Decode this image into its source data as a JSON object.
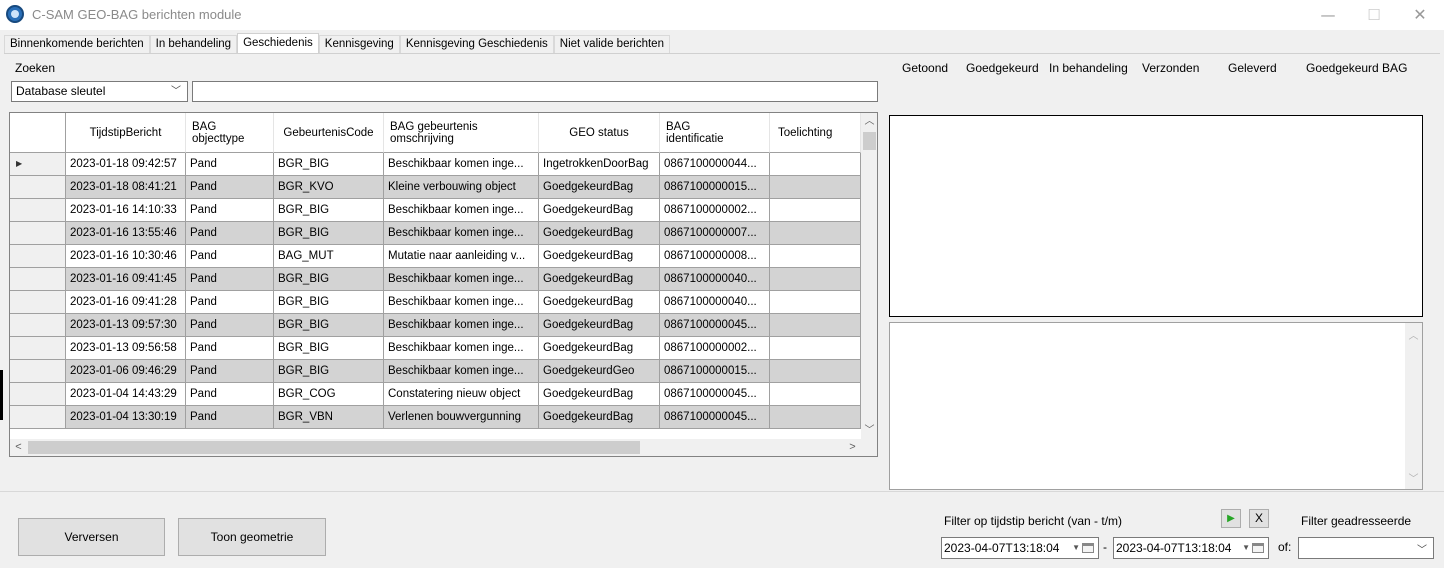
{
  "window": {
    "title": "C-SAM GEO-BAG berichten module",
    "minimize": "—",
    "maximize": "☐",
    "close": "✕"
  },
  "tabs": [
    {
      "label": "Binnenkomende berichten",
      "active": false
    },
    {
      "label": "In behandeling",
      "active": false
    },
    {
      "label": "Geschiedenis",
      "active": true
    },
    {
      "label": "Kennisgeving",
      "active": false
    },
    {
      "label": "Kennisgeving Geschiedenis",
      "active": false
    },
    {
      "label": "Niet valide berichten",
      "active": false
    }
  ],
  "search": {
    "label": "Zoeken",
    "field_selected": "Database sleutel",
    "query": ""
  },
  "status_columns": [
    "Getoond",
    "Goedgekeurd",
    "In behandeling",
    "Verzonden",
    "Geleverd",
    "Goedgekeurd BAG"
  ],
  "grid": {
    "columns": [
      "TijdstipBericht",
      "BAG\nobjecttype",
      "GebeurtenisCode",
      "BAG gebeurtenis\nomschrijving",
      "GEO status",
      "BAG\nidentificatie",
      "Toelichting"
    ],
    "current_row_indicator": "▶",
    "rows": [
      [
        "2023-01-18 09:42:57",
        "Pand",
        "BGR_BIG",
        "Beschikbaar komen inge...",
        "IngetrokkenDoorBag",
        "0867100000044...",
        ""
      ],
      [
        "2023-01-18 08:41:21",
        "Pand",
        "BGR_KVO",
        "Kleine verbouwing object",
        "GoedgekeurdBag",
        "0867100000015...",
        ""
      ],
      [
        "2023-01-16 14:10:33",
        "Pand",
        "BGR_BIG",
        "Beschikbaar komen inge...",
        "GoedgekeurdBag",
        "0867100000002...",
        ""
      ],
      [
        "2023-01-16 13:55:46",
        "Pand",
        "BGR_BIG",
        "Beschikbaar komen inge...",
        "GoedgekeurdBag",
        "0867100000007...",
        ""
      ],
      [
        "2023-01-16 10:30:46",
        "Pand",
        "BAG_MUT",
        "Mutatie naar aanleiding v...",
        "GoedgekeurdBag",
        "0867100000008...",
        ""
      ],
      [
        "2023-01-16 09:41:45",
        "Pand",
        "BGR_BIG",
        "Beschikbaar komen inge...",
        "GoedgekeurdBag",
        "0867100000040...",
        ""
      ],
      [
        "2023-01-16 09:41:28",
        "Pand",
        "BGR_BIG",
        "Beschikbaar komen inge...",
        "GoedgekeurdBag",
        "0867100000040...",
        ""
      ],
      [
        "2023-01-13 09:57:30",
        "Pand",
        "BGR_BIG",
        "Beschikbaar komen inge...",
        "GoedgekeurdBag",
        "0867100000045...",
        ""
      ],
      [
        "2023-01-13 09:56:58",
        "Pand",
        "BGR_BIG",
        "Beschikbaar komen inge...",
        "GoedgekeurdBag",
        "0867100000002...",
        ""
      ],
      [
        "2023-01-06 09:46:29",
        "Pand",
        "BGR_BIG",
        "Beschikbaar komen inge...",
        "GoedgekeurdGeo",
        "0867100000015...",
        ""
      ],
      [
        "2023-01-04 14:43:29",
        "Pand",
        "BGR_COG",
        "Constatering nieuw object",
        "GoedgekeurdBag",
        "0867100000045...",
        ""
      ],
      [
        "2023-01-04 13:30:19",
        "Pand",
        "BGR_VBN",
        "Verlenen bouwvergunning",
        "GoedgekeurdBag",
        "0867100000045...",
        ""
      ]
    ]
  },
  "buttons": {
    "refresh": "Verversen",
    "show_geometry": "Toon geometrie",
    "apply_filter": "▶",
    "clear_filter": "X"
  },
  "filter": {
    "label": "Filter op tijdstip bericht (van - t/m)",
    "from": "2023-04-07T13:18:04",
    "separator": "-",
    "to": "2023-04-07T13:18:04",
    "addressee_label": "Filter geadresseerde",
    "of_label": "of:",
    "addressee_value": ""
  },
  "icons": {
    "app": "globe-icon",
    "dropdown": "chevron-down-icon",
    "calendar": "calendar-icon"
  },
  "colors": {
    "alt_row": "#d3d3d3",
    "window_bg": "#f0f0f0",
    "play_green": "#26a626"
  }
}
